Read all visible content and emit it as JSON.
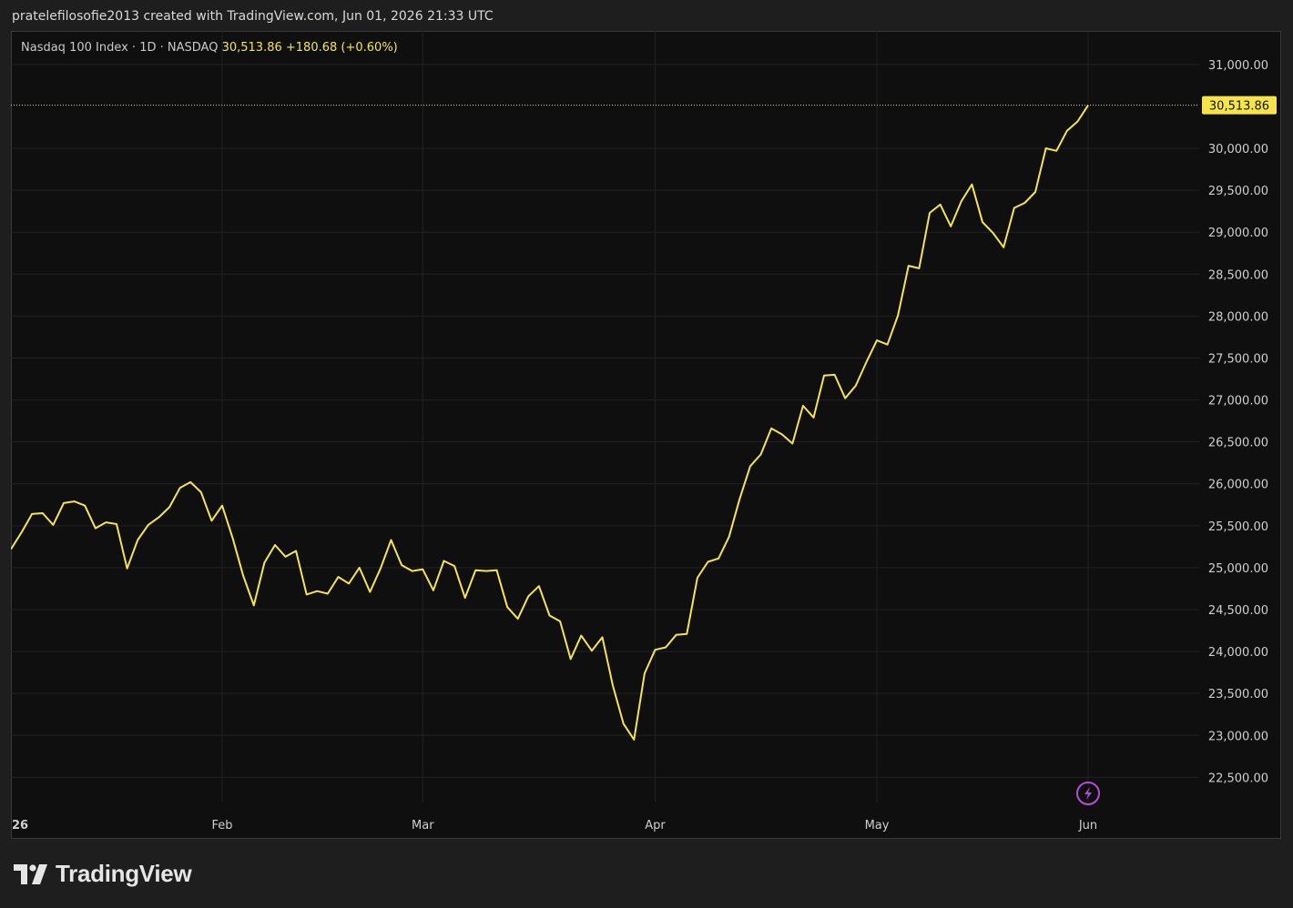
{
  "caption": "pratelefilosofie2013 created with TradingView.com, Jun 01, 2026 21:33 UTC",
  "legend": {
    "symbol": "Nasdaq 100 Index · 1D · NASDAQ",
    "last": "30,513.86",
    "change": "+180.68 (+0.60%)"
  },
  "price_tag": "30,513.86",
  "footer": {
    "brand": "TradingView"
  },
  "colors": {
    "line": "#f5e44a",
    "background": "#0f0f0f",
    "alert_icon": "#b04fd6"
  },
  "icons": {
    "alert": "lightning-icon",
    "logo": "tradingview-logo-icon"
  },
  "chart_data": {
    "type": "line",
    "x_tick_labels": [
      "26",
      "Feb",
      "Mar",
      "Apr",
      "May",
      "Jun"
    ],
    "y_tick_labels": [
      "31,000.00",
      "30,000.00",
      "29,500.00",
      "29,000.00",
      "28,500.00",
      "28,000.00",
      "27,500.00",
      "27,000.00",
      "26,500.00",
      "26,000.00",
      "25,500.00",
      "25,000.00",
      "24,500.00",
      "24,000.00",
      "23,500.00",
      "23,000.00",
      "22,500.00"
    ],
    "y_ticks": [
      31000,
      30000,
      29500,
      29000,
      28500,
      28000,
      27500,
      27000,
      26500,
      26000,
      25500,
      25000,
      24500,
      24000,
      23500,
      23000,
      22500
    ],
    "ylim": [
      22200,
      31400
    ],
    "last_value": 30513.86,
    "grid": true,
    "series": [
      {
        "values": [
          25220,
          25420,
          25640,
          25650,
          25510,
          25770,
          25790,
          25740,
          25470,
          25540,
          25520,
          24990,
          25330,
          25510,
          25600,
          25720,
          25950,
          26020,
          25900,
          25560,
          25740,
          25350,
          24900,
          24550,
          25060,
          25270,
          25130,
          25200,
          24680,
          24720,
          24690,
          24890,
          24810,
          25000,
          24710,
          24990,
          25330,
          25030,
          24960,
          24980,
          24730,
          25080,
          25020,
          24640,
          24970,
          24960,
          24970,
          24530,
          24390,
          24660,
          24780,
          24430,
          24360,
          23910,
          24190,
          24010,
          24170,
          23590,
          23140,
          22950,
          23740,
          24020,
          24050,
          24200,
          24210,
          24880,
          25070,
          25110,
          25370,
          25820,
          26210,
          26350,
          26660,
          26590,
          26480,
          26930,
          26790,
          27290,
          27300,
          27020,
          27170,
          27450,
          27710,
          27660,
          28010,
          28600,
          28570,
          29230,
          29330,
          29070,
          29370,
          29570,
          29120,
          28990,
          28820,
          29290,
          29350,
          29480,
          30000,
          29970,
          30210,
          30320,
          30514
        ]
      }
    ]
  }
}
